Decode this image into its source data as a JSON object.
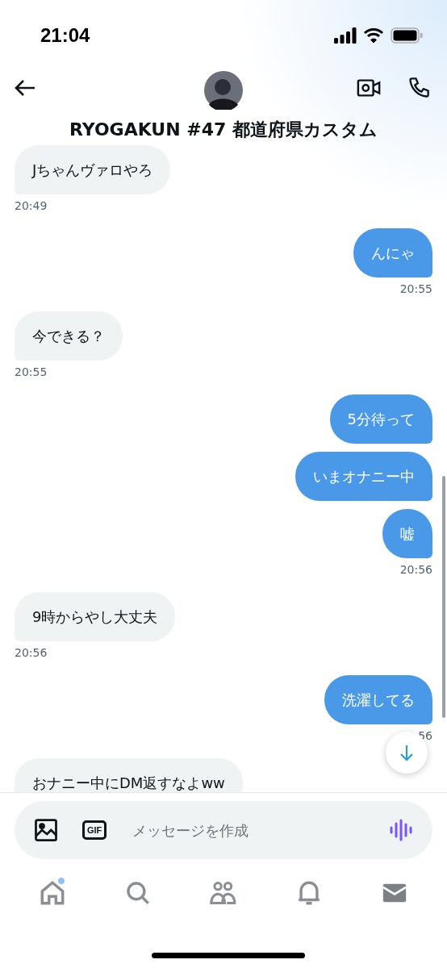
{
  "status_bar": {
    "time": "21:04"
  },
  "header": {
    "title": "RYOGAKUN #47 都道府県カスタム"
  },
  "messages": [
    {
      "kind": "received",
      "text": "Jちゃんヴァロやろ",
      "time": "20:49"
    },
    {
      "kind": "sent",
      "text": "んにゃ",
      "time": "20:55"
    },
    {
      "kind": "received",
      "text": "今できる？",
      "time": "20:55"
    },
    {
      "kind": "sent",
      "text": "5分待って"
    },
    {
      "kind": "sent",
      "text": "いまオナニー中"
    },
    {
      "kind": "sent",
      "text": "嘘",
      "time": "20:56"
    },
    {
      "kind": "received",
      "text": "9時からやし大丈夫",
      "time": "20:56"
    },
    {
      "kind": "sent",
      "text": "洗濯してる",
      "time": "56"
    },
    {
      "kind": "received",
      "text": "おナニー中にDM返すなよww"
    }
  ],
  "composer": {
    "gif_label": "GIF",
    "placeholder": "メッセージを作成"
  },
  "nav": [
    {
      "kind": "home",
      "selected": false,
      "badge": true
    },
    {
      "kind": "search",
      "selected": false,
      "badge": false
    },
    {
      "kind": "communities",
      "selected": false,
      "badge": false
    },
    {
      "kind": "notifications",
      "selected": false,
      "badge": false
    },
    {
      "kind": "messages",
      "selected": true,
      "badge": false
    }
  ]
}
